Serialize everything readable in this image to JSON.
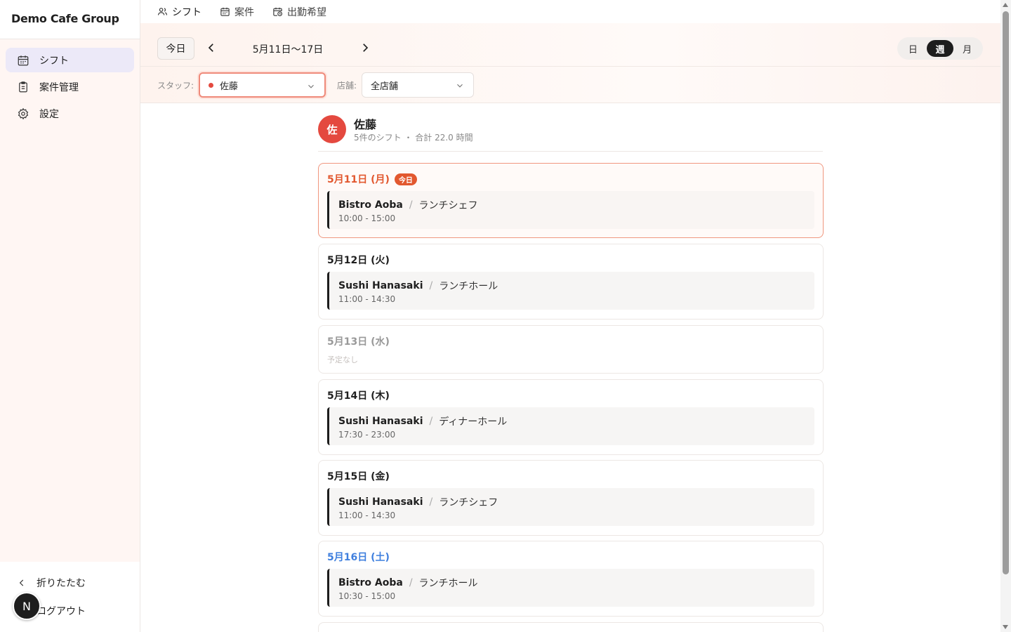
{
  "sidebar": {
    "brand": "Demo Cafe Group",
    "items": [
      {
        "label": "シフト",
        "icon": "calendar-icon",
        "active": true
      },
      {
        "label": "案件管理",
        "icon": "clipboard-icon",
        "active": false
      },
      {
        "label": "設定",
        "icon": "gear-icon",
        "active": false
      }
    ],
    "collapse_label": "折りたたむ",
    "logout_label": "ログアウト",
    "avatar_initial": "N"
  },
  "tabs": [
    {
      "label": "シフト",
      "icon": "users-icon",
      "active": true
    },
    {
      "label": "案件",
      "icon": "calendar-icon",
      "active": false
    },
    {
      "label": "出勤希望",
      "icon": "calendar-clock-icon",
      "active": false
    }
  ],
  "toolbar": {
    "today_label": "今日",
    "date_range": "5月11日〜17日",
    "view_modes": [
      {
        "label": "日",
        "active": false
      },
      {
        "label": "週",
        "active": true
      },
      {
        "label": "月",
        "active": false
      }
    ],
    "staff_label": "スタッフ:",
    "staff_value": "佐藤",
    "store_label": "店舗:",
    "store_value": "全店舗"
  },
  "profile": {
    "initial": "佐",
    "name": "佐藤",
    "summary": "5件のシフト ・ 合計 22.0 時間"
  },
  "days": [
    {
      "title": "5月11日 (月)",
      "badge": "今日",
      "kind": "today",
      "shift": {
        "store": "Bistro Aoba",
        "role": "ランチシェフ",
        "time": "10:00 - 15:00"
      }
    },
    {
      "title": "5月12日 (火)",
      "kind": "normal",
      "shift": {
        "store": "Sushi Hanasaki",
        "role": "ランチホール",
        "time": "11:00 - 14:30"
      }
    },
    {
      "title": "5月13日 (水)",
      "kind": "empty",
      "empty_text": "予定なし"
    },
    {
      "title": "5月14日 (木)",
      "kind": "normal",
      "shift": {
        "store": "Sushi Hanasaki",
        "role": "ディナーホール",
        "time": "17:30 - 23:00"
      }
    },
    {
      "title": "5月15日 (金)",
      "kind": "normal",
      "shift": {
        "store": "Sushi Hanasaki",
        "role": "ランチシェフ",
        "time": "11:00 - 14:30"
      }
    },
    {
      "title": "5月16日 (土)",
      "kind": "sat",
      "shift": {
        "store": "Bistro Aoba",
        "role": "ランチホール",
        "time": "10:30 - 15:00"
      }
    }
  ],
  "colors": {
    "accent": "#e8603c",
    "staff_dot": "#e4493f",
    "saturday": "#3f7fde"
  }
}
